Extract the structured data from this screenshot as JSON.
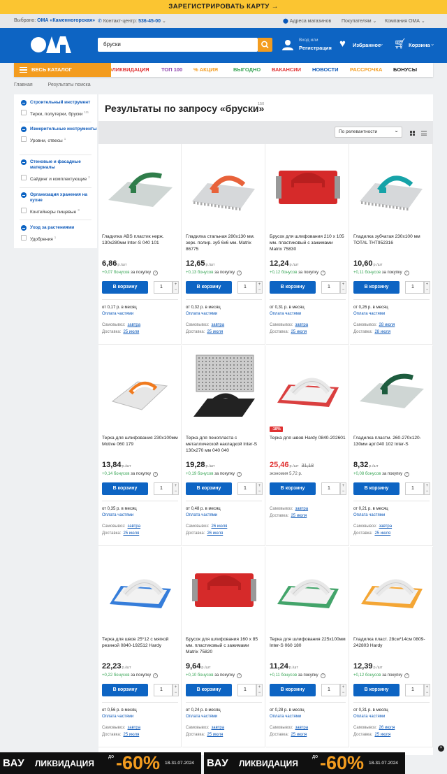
{
  "topbar": {
    "label": "ЗАРЕГИСТРИРОВАТЬ КАРТУ"
  },
  "infobar": {
    "selected_label": "Выбрано:",
    "store": "ОМА «Каменногорская»",
    "contact_label": "Контакт-центр:",
    "phone": "536-45-00",
    "stores": "Адреса магазинов",
    "buyers": "Покупателям",
    "company": "Компания ОМА"
  },
  "header": {
    "logo": "ОМА",
    "search_value": "бруски",
    "login_small": "Вход или",
    "login": "Регистрация",
    "favorites": "Избранное",
    "cart": "Корзина"
  },
  "nav": {
    "catalog": "ВЕСЬ КАТАЛОГ",
    "items": [
      {
        "label": "ЛИКВИДАЦИЯ",
        "color": "#e03131"
      },
      {
        "label": "ТОП 100",
        "color": "#8e44ad"
      },
      {
        "label": "АКЦИЯ",
        "color": "#f39c1f"
      },
      {
        "label": "ВЫГОДНО",
        "color": "#3aa657"
      },
      {
        "label": "ВАКАНСИИ",
        "color": "#e03131"
      },
      {
        "label": "НОВОСТИ",
        "color": "#0a57b8"
      },
      {
        "label": "РАССРОЧКА",
        "color": "#f39c1f"
      },
      {
        "label": "БОНУСЫ",
        "color": "#222222"
      }
    ]
  },
  "breadcrumbs": [
    "Главная",
    "Результаты поиска"
  ],
  "filters": [
    {
      "title": "Строительный инструмент",
      "option": "Терки, полутерки, бруски",
      "count": "111"
    },
    {
      "title": "Измерительные инструменты",
      "option": "Уровни, отвесы",
      "count": "1"
    },
    {
      "title": "Стеновые и фасадные материалы",
      "option": "Сайдинг и комплектующие",
      "count": "2"
    },
    {
      "title": "Организация хранения на кухне",
      "option": "Контейнеры пищевые",
      "count": "3"
    },
    {
      "title": "Уход за растениями",
      "option": "Удобрения",
      "count": "1"
    }
  ],
  "results": {
    "title": "Результаты по запросу «бруски»",
    "count": "150",
    "sort": "По релевантности"
  },
  "common": {
    "unit": "р./шт",
    "buy": "В корзину",
    "qty": "1",
    "credit_link": "Оплата частями",
    "pickup_label": "Самовывоз:",
    "delivery_label": "Доставка:",
    "bonus_suffix": "за покупку",
    "help": "?"
  },
  "products": [
    {
      "name": "Гладилка ABS пластик нерж. 130х280мм Inter-S 040 101",
      "price": "6,86",
      "bonus": "+0,07 бонусов",
      "credit": "от 0,17 р. в месяц",
      "pickup": "завтра",
      "delivery": "25 июля",
      "color": "#2f7d4a"
    },
    {
      "name": "Гладилка стальная 280х130 мм. зерк. полир. зуб 6х6 мм. Matrix 86775",
      "price": "12,65",
      "bonus": "+0,13 бонусов",
      "credit": "от 0,32 р. в месяц",
      "pickup": "завтра",
      "delivery": "25 июля",
      "color": "#e8623a"
    },
    {
      "name": "Брусок для шлифования 210 х 105 мм. пластиковый с зажимами Matrix 75830",
      "price": "12,24",
      "bonus": "+0,12 бонусов",
      "credit": "от 0,31 р. в месяц",
      "pickup": "завтра",
      "delivery": "25 июля",
      "color": "#d62a2a"
    },
    {
      "name": "Гладилка зубчатая 230х100 мм TOTAL THT952316",
      "price": "10,60",
      "bonus": "+0,11 бонусов",
      "credit": "от 0,26 р. в месяц",
      "pickup": "28 июля",
      "delivery": "28 июля",
      "color": "#16a3a8"
    },
    {
      "name": "Терка для шлифования 230х100мм Motive 060 179",
      "price": "13,84",
      "bonus": "+0,14 бонусов",
      "credit": "от 0,35 р. в месяц",
      "pickup": "завтра",
      "delivery": "25 июля",
      "color": "#f07a1e"
    },
    {
      "name": "Терка для пенопласта с металлической накладкой Inter-S 130х270 мм 040 040",
      "price": "19,28",
      "bonus": "+0,19 бонусов",
      "credit": "от 0,48 р. в месяц",
      "pickup": "26 июля",
      "delivery": "26 июля",
      "color": "#222222"
    },
    {
      "name": "Терка для швов Hardy 0840-202601",
      "price": "25,46",
      "old_price": "31,18",
      "discount": "-18%",
      "economy": "экономия 5,72 р.",
      "pickup": "завтра",
      "delivery": "25 июля",
      "color": "#d62a2a"
    },
    {
      "name": "Гладилка пластм. 260-270х120-130мм арт.040 102 Inter-S",
      "price": "8,32",
      "bonus": "+0,08 бонусов",
      "credit": "от 0,21 р. в месяц",
      "pickup": "завтра",
      "delivery": "25 июля",
      "color": "#1d5c3e"
    },
    {
      "name": "Терка для швов 25*12 с мягкой резиной 0840-192512 Hardy",
      "price": "22,23",
      "bonus": "+0,22 бонусов",
      "credit": "от 0,56 р. в месяц",
      "pickup": "завтра",
      "delivery": "25 июля",
      "color": "#1f6fd6"
    },
    {
      "name": "Брусок для шлифования 160 х 85 мм. пластиковый с зажимами Matrix 75820",
      "price": "9,64",
      "bonus": "+0,10 бонусов",
      "credit": "от 0,24 р. в месяц",
      "pickup": "завтра",
      "delivery": "25 июля",
      "color": "#d62a2a"
    },
    {
      "name": "Терка для шлифования 225х100мм Inter-S 060 180",
      "price": "11,24",
      "bonus": "+0,11 бонусов",
      "credit": "от 0,28 р. в месяц",
      "pickup": "завтра",
      "delivery": "25 июля",
      "color": "#2f9a5a"
    },
    {
      "name": "Гладилка пласт. 28см*14см 0809-242803 Hardy",
      "price": "12,39",
      "bonus": "+0,12 бонусов",
      "credit": "от 0,31 р. в месяц",
      "pickup": "26 июля",
      "delivery": "25 июля",
      "color": "#f39c1f"
    }
  ],
  "banner": {
    "vau": "ВАУ",
    "title": "ЛИКВИДАЦИЯ",
    "do": "до",
    "percent": "-60%",
    "dates": "18-31.07.2024"
  }
}
